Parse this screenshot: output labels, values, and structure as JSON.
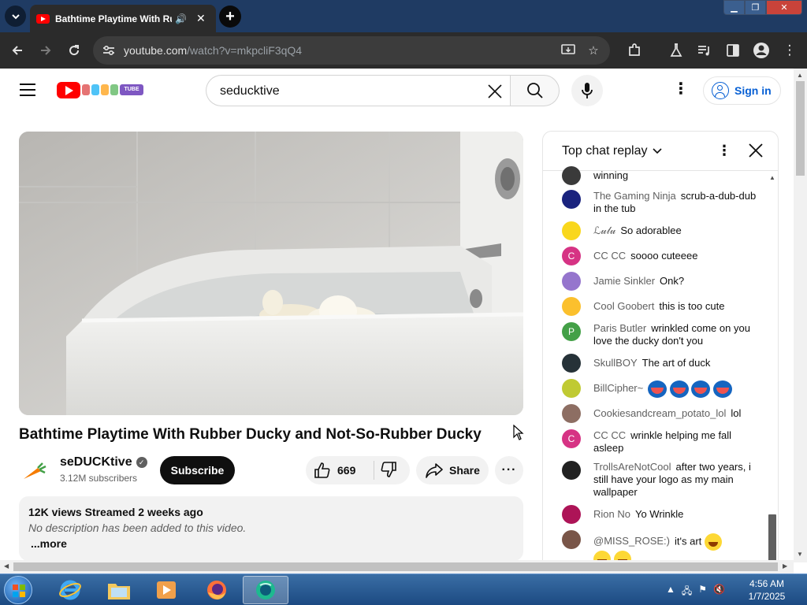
{
  "browser": {
    "tab_title": "Bathtime Playtime With Rubber Ducky",
    "url_host": "youtube.com",
    "url_path": "/watch?v=mkpcliF3qQ4"
  },
  "header": {
    "search_query": "seducktive",
    "signin_label": "Sign in"
  },
  "video": {
    "title": "Bathtime Playtime With Rubber Ducky and Not-So-Rubber Ducky",
    "channel_name": "seDUCKtive",
    "subscribers": "3.12M subscribers",
    "subscribe_label": "Subscribe",
    "likes": "669",
    "share_label": "Share",
    "meta": "12K views  Streamed 2 weeks ago",
    "description": "No description has been added to this video.",
    "more_label": "...more"
  },
  "chat": {
    "title": "Top chat replay",
    "messages": [
      {
        "author": "",
        "text": "winning",
        "color": "#3a3a3a"
      },
      {
        "author": "The Gaming Ninja",
        "text": "scrub-a-dub-dub in the tub",
        "color": "#1a237e"
      },
      {
        "author": "ℒ𝓊𝓁𝓊",
        "text": "So adorablee",
        "color": "#f9d71c"
      },
      {
        "author": "CC CC",
        "text": "soooo cuteeee",
        "color": "#d63384",
        "initial": "C"
      },
      {
        "author": "Jamie Sinkler",
        "text": "Onk?",
        "color": "#9575cd"
      },
      {
        "author": "Cool Goobert",
        "text": "this is too cute",
        "color": "#fbc02d"
      },
      {
        "author": "Paris Butler",
        "text": "wrinkled come on you love the ducky don't you",
        "color": "#43a047",
        "initial": "P"
      },
      {
        "author": "SkullBOY",
        "text": "The art of duck",
        "color": "#263238"
      },
      {
        "author": "BillCipher~",
        "text": "",
        "color": "#c0ca33"
      },
      {
        "author": "Cookiesandcream_potato_lol",
        "text": "lol",
        "color": "#8d6e63"
      },
      {
        "author": "CC CC",
        "text": "wrinkle helping me fall asleep",
        "color": "#d63384",
        "initial": "C"
      },
      {
        "author": "TrollsAreNotCool",
        "text": "after two years, i still have your logo as my main wallpaper",
        "color": "#212121"
      },
      {
        "author": "Rion No",
        "text": "Yo Wrinkle",
        "color": "#ad1457"
      },
      {
        "author": "@MISS_ROSE:)",
        "text": "it's art",
        "color": "#795548"
      }
    ]
  },
  "taskbar": {
    "time": "4:56 AM",
    "date": "1/7/2025"
  },
  "colors": {
    "youtube_red": "#ff0000",
    "link_blue": "#065fd4",
    "browser_dark": "#2b2b2b",
    "tabstrip": "#1f3b63"
  }
}
